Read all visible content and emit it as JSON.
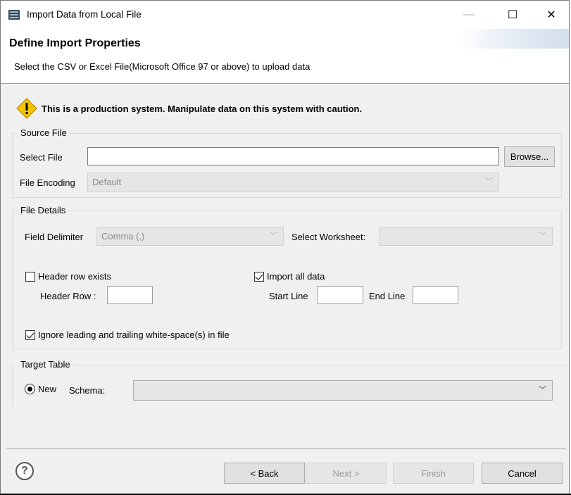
{
  "window": {
    "title": "Import Data from Local File",
    "minimize": "—",
    "maximize": "☐",
    "close": "✕"
  },
  "banner": {
    "title": "Define Import Properties",
    "description": "Select the CSV or Excel File(Microsoft Office 97 or above) to upload data"
  },
  "warning": {
    "text": "This is a production system. Manipulate data on this system with caution."
  },
  "source_file": {
    "legend": "Source File",
    "select_file_label": "Select File",
    "select_file_value": "",
    "browse_label": "Browse...",
    "encoding_label": "File Encoding",
    "encoding_value": "Default"
  },
  "file_details": {
    "legend": "File Details",
    "delimiter_label": "Field Delimiter",
    "delimiter_value": "Comma (,)",
    "worksheet_label": "Select Worksheet:",
    "worksheet_value": "",
    "header_row_exists_label": "Header row exists",
    "header_row_exists_checked": false,
    "header_row_label": "Header Row :",
    "header_row_value": "",
    "import_all_label": "Import all data",
    "import_all_checked": true,
    "start_line_label": "Start Line",
    "start_line_value": "",
    "end_line_label": "End Line",
    "end_line_value": "",
    "ignore_ws_label": "Ignore leading and trailing white-space(s) in file",
    "ignore_ws_checked": true
  },
  "target_table": {
    "legend": "Target Table",
    "new_label": "New",
    "new_selected": true,
    "schema_label": "Schema:",
    "schema_value": ""
  },
  "footer": {
    "help": "?",
    "back_label": "< Back",
    "next_label": "Next >",
    "finish_label": "Finish",
    "cancel_label": "Cancel"
  },
  "colors": {
    "window_bg": "#f0f0f0",
    "warning_yellow": "#f5c400"
  }
}
